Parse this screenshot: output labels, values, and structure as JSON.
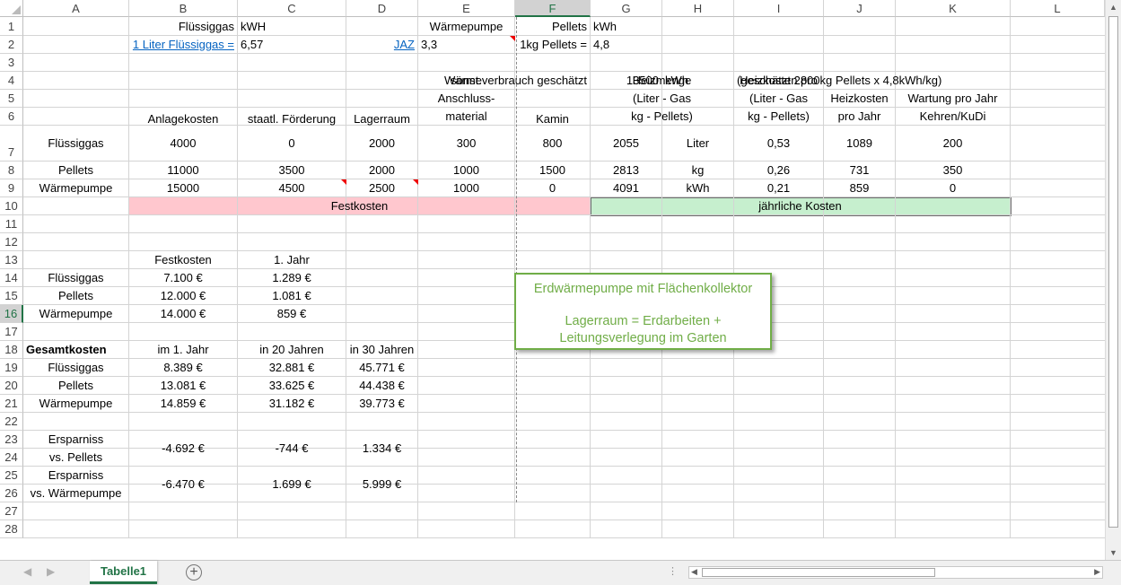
{
  "columns": [
    "A",
    "B",
    "C",
    "D",
    "E",
    "F",
    "G",
    "H",
    "I",
    "J",
    "K",
    "L"
  ],
  "rows": [
    "1",
    "2",
    "3",
    "4",
    "5",
    "6",
    "7",
    "8",
    "9",
    "10",
    "11",
    "12",
    "13",
    "14",
    "15",
    "16",
    "17",
    "18",
    "19",
    "20",
    "21",
    "22",
    "23",
    "24",
    "25",
    "26",
    "27",
    "28"
  ],
  "selected_column": "F",
  "selected_row": "16",
  "cells": {
    "B1": "Flüssiggas",
    "C1": "kWH",
    "E1": "Wärmepumpe",
    "F1": "Pellets",
    "G1": "kWh",
    "B2": "1 Liter Flüssiggas =",
    "C2": "6,57",
    "D2": "JAZ",
    "E2": "3,3",
    "F2": "1kg Pellets =",
    "G2": "4,8",
    "E4": "Wärmeverbrauch geschätzt",
    "G4": "13500",
    "H4": "kWh",
    "I4": "(geschätzt 2800kg Pellets x 4,8kWh/kg)",
    "B6": "Anlagekosten",
    "C6": "staatl. Förderung",
    "D6": "Lagerraum",
    "E6": [
      "sonst.",
      "Anschluss-",
      "material"
    ],
    "F6": "Kamin",
    "G6": [
      "Heizmenge",
      "(Liter - Gas",
      "kg - Pellets)"
    ],
    "I6": [
      "Heizkosten pro",
      "(Liter - Gas",
      "kg - Pellets)"
    ],
    "J6": [
      "Heizkosten",
      "pro Jahr"
    ],
    "K6": [
      "Wartung pro Jahr",
      "Kehren/KuDi"
    ],
    "A7": "Flüssiggas",
    "B7": "4000",
    "C7": "0",
    "D7": "2000",
    "E7": "300",
    "F7": "800",
    "G7": "2055",
    "H7": "Liter",
    "I7": "0,53",
    "J7": "1089",
    "K7": "200",
    "A8": "Pellets",
    "B8": "11000",
    "C8": "3500",
    "D8": "2000",
    "E8": "1000",
    "F8": "1500",
    "G8": "2813",
    "H8": "kg",
    "I8": "0,26",
    "J8": "731",
    "K8": "350",
    "A9": "Wärmepumpe",
    "B9": "15000",
    "C9": "4500",
    "D9": "2500",
    "E9": "1000",
    "F9": "0",
    "G9": "4091",
    "H9": "kWh",
    "I9": "0,21",
    "J9": "859",
    "K9": "0",
    "B10": "Festkosten",
    "G10": "jährliche Kosten",
    "B13": "Festkosten",
    "C13": "1. Jahr",
    "A14": "Flüssiggas",
    "B14": "7.100 €",
    "C14": "1.289 €",
    "A15": "Pellets",
    "B15": "12.000 €",
    "C15": "1.081 €",
    "A16": "Wärmepumpe",
    "B16": "14.000 €",
    "C16": "859 €",
    "A18": "Gesamtkosten",
    "B18": "im 1. Jahr",
    "C18": "in 20 Jahren",
    "D18": "in 30 Jahren",
    "A19": "Flüssiggas",
    "B19": "8.389 €",
    "C19": "32.881 €",
    "D19": "45.771 €",
    "A20": "Pellets",
    "B20": "13.081 €",
    "C20": "33.625 €",
    "D20": "44.438 €",
    "A21": "Wärmepumpe",
    "B21": "14.859 €",
    "C21": "31.182 €",
    "D21": "39.773 €",
    "A23": [
      "Ersparniss",
      "vs. Pellets"
    ],
    "B23": "-4.692 €",
    "C23": "-744 €",
    "D23": "1.334 €",
    "A25": [
      "Ersparniss",
      "vs. Wärmepumpe"
    ],
    "B25": "-6.470 €",
    "C25": "1.699 €",
    "D25": "5.999 €"
  },
  "textbox": {
    "line1": "Erdwärmepumpe mit Flächenkollektor",
    "line2": "Lagerraum = Erdarbeiten +",
    "line3": "Leitungsverlegung im Garten"
  },
  "sheet_tab": "Tabelle1",
  "colors": {
    "accent": "#217346",
    "red_fill": "#ffc7ce",
    "green_fill": "#c6efce",
    "textbox": "#70ad47",
    "link": "#0563c1"
  }
}
